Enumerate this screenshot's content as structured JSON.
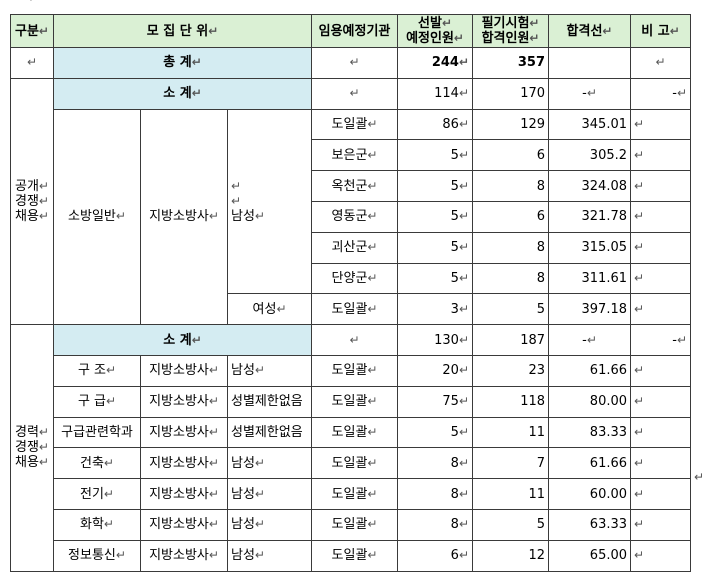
{
  "ret": "↵",
  "header": {
    "category": "구분",
    "unit": "모 집 단 위",
    "agency": "임용예정기관",
    "select_l1": "선발",
    "select_l2": "예정인원",
    "written_l1": "필기시험",
    "written_l2": "합격인원",
    "cutoff": "합격선",
    "note": "비 고"
  },
  "total": {
    "label": "총 계",
    "selected": "244",
    "written": "357"
  },
  "open": {
    "category": [
      "공개",
      "경쟁",
      "채용"
    ],
    "field": "소방일반",
    "rank": "지방소방사",
    "subtotal": {
      "label": "소 계",
      "selected": "114",
      "written": "170",
      "cutoff": "-",
      "note": "-"
    },
    "male": "남성",
    "female": "여성",
    "rows": [
      {
        "agency": "도일괄",
        "selected": "86",
        "written": "129",
        "cutoff": "345.01"
      },
      {
        "agency": "보은군",
        "selected": "5",
        "written": "6",
        "cutoff": "305.2"
      },
      {
        "agency": "옥천군",
        "selected": "5",
        "written": "8",
        "cutoff": "324.08"
      },
      {
        "agency": "영동군",
        "selected": "5",
        "written": "6",
        "cutoff": "321.78"
      },
      {
        "agency": "괴산군",
        "selected": "5",
        "written": "8",
        "cutoff": "315.05"
      },
      {
        "agency": "단양군",
        "selected": "5",
        "written": "8",
        "cutoff": "311.61"
      },
      {
        "agency": "도일괄",
        "selected": "3",
        "written": "5",
        "cutoff": "397.18"
      }
    ]
  },
  "career": {
    "category": [
      "경력",
      "경쟁",
      "채용"
    ],
    "subtotal": {
      "label": "소 계",
      "selected": "130",
      "written": "187",
      "cutoff": "-",
      "note": "-"
    },
    "rows": [
      {
        "field": "구 조",
        "rank": "지방소방사",
        "gender": "남성",
        "agency": "도일괄",
        "selected": "20",
        "written": "23",
        "cutoff": "61.66"
      },
      {
        "field": "구 급",
        "rank": "지방소방사",
        "gender": "성별제한없음",
        "agency": "도일괄",
        "selected": "75",
        "written": "118",
        "cutoff": "80.00"
      },
      {
        "field": "구급관련학과",
        "rank": "지방소방사",
        "gender": "성별제한없음",
        "agency": "도일괄",
        "selected": "5",
        "written": "11",
        "cutoff": "83.33"
      },
      {
        "field": "건축",
        "rank": "지방소방사",
        "gender": "남성",
        "agency": "도일괄",
        "selected": "8",
        "written": "7",
        "cutoff": "61.66"
      },
      {
        "field": "전기",
        "rank": "지방소방사",
        "gender": "남성",
        "agency": "도일괄",
        "selected": "8",
        "written": "11",
        "cutoff": "60.00"
      },
      {
        "field": "화학",
        "rank": "지방소방사",
        "gender": "남성",
        "agency": "도일괄",
        "selected": "8",
        "written": "5",
        "cutoff": "63.33"
      },
      {
        "field": "정보통신",
        "rank": "지방소방사",
        "gender": "남성",
        "agency": "도일괄",
        "selected": "6",
        "written": "12",
        "cutoff": "65.00"
      }
    ]
  }
}
